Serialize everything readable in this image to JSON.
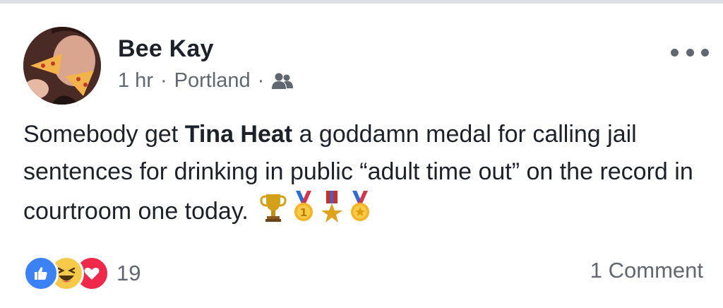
{
  "post": {
    "author_name": "Bee Kay",
    "time": "1 hr",
    "separator": "·",
    "location": "Portland",
    "audience_icon": "friends-icon",
    "text_before": "Somebody get ",
    "mention": "Tina Heat",
    "text_after": " a goddamn medal for calling jail sentences for drinking in public “adult time out” on the record in courtroom one today.",
    "emojis": [
      "trophy-icon",
      "first-place-medal-icon",
      "military-medal-icon",
      "sports-medal-icon"
    ]
  },
  "reactions": {
    "types": [
      "like-icon",
      "haha-icon",
      "love-icon"
    ],
    "count": "19",
    "like_color": "#3b82f6",
    "haha_color": "#f7c948",
    "love_color": "#f0284a"
  },
  "comments": {
    "label": "1 Comment"
  },
  "colors": {
    "text": "#1d2129",
    "meta": "#616770",
    "divider": "#dddfe2"
  }
}
